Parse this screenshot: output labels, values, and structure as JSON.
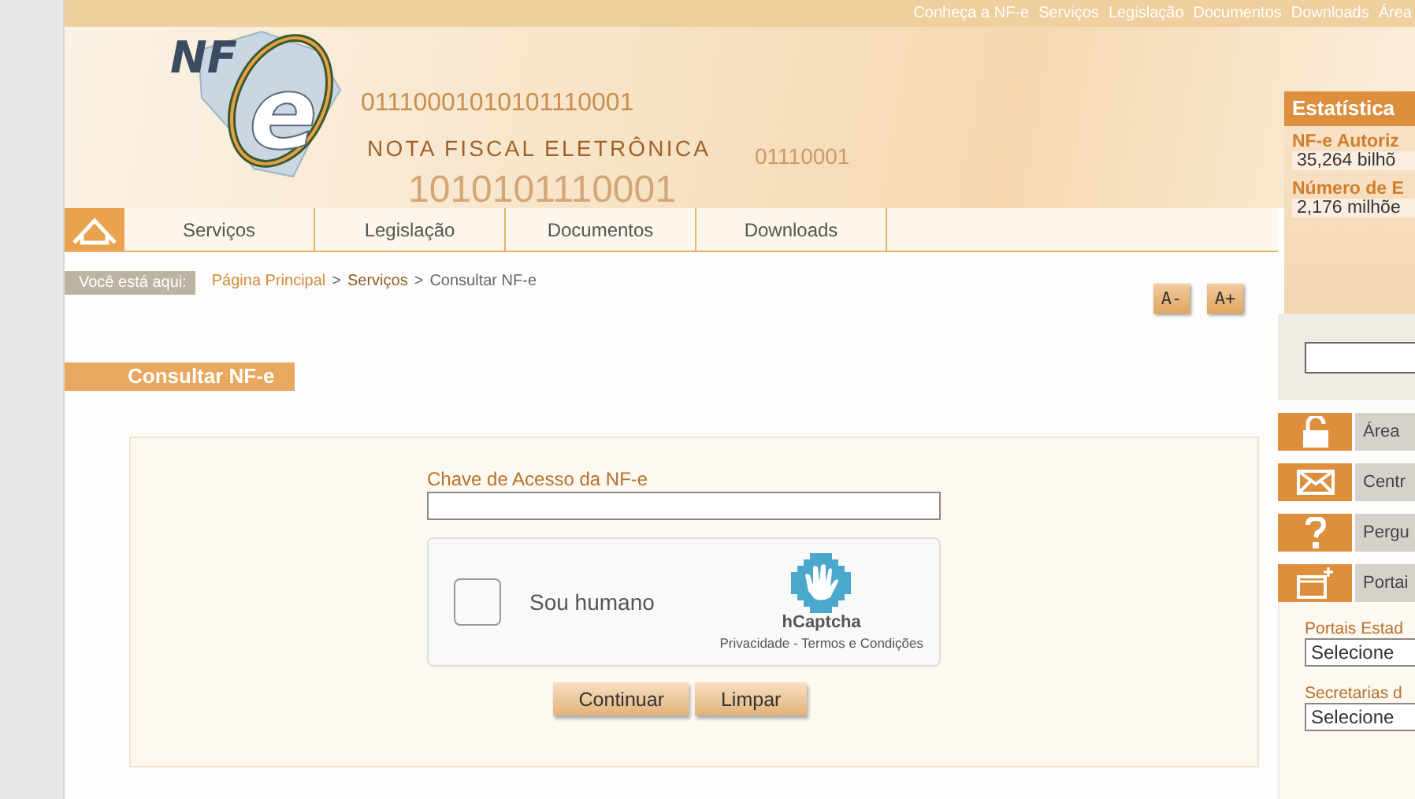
{
  "top_links": [
    "Conheça a NF-e",
    "Serviços",
    "Legislação",
    "Documentos",
    "Downloads",
    "Área"
  ],
  "logo": {
    "prefix": "NF",
    "letter": "e",
    "subtitle": "NOTA FISCAL ELETRÔNICA"
  },
  "banner_digits": [
    "01110001010101110001",
    "01110001",
    "1010101110001"
  ],
  "nav": {
    "items": [
      "Serviços",
      "Legislação",
      "Documentos",
      "Downloads"
    ]
  },
  "breadcrumb": {
    "label": "Você está aqui:",
    "links": [
      "Página Principal",
      "Serviços"
    ],
    "current": "Consultar NF-e",
    "separator": ">"
  },
  "font_buttons": [
    "A-",
    "A+"
  ],
  "page_title": "Consultar NF-e",
  "form": {
    "field_label": "Chave de Acesso da NF-e",
    "captcha": {
      "checked": false,
      "label": "Sou humano",
      "brand": "hCaptcha",
      "links": "Privacidade - Termos e Condições"
    },
    "buttons": [
      "Continuar",
      "Limpar"
    ]
  },
  "sidebar": {
    "title": "Estatística",
    "stats": [
      {
        "label": "NF-e Autoriz",
        "value": "35,264 bilhõ"
      },
      {
        "label": "Número de E",
        "value": "2,176 milhõe"
      }
    ],
    "menu": [
      {
        "kind": "lock",
        "label": "Área"
      },
      {
        "kind": "mail",
        "label": "Centr"
      },
      {
        "kind": "help",
        "label": "Pergu"
      },
      {
        "kind": "window",
        "label": "Portai"
      }
    ],
    "selects": [
      {
        "label": "Portais Estad",
        "value": "Selecione"
      },
      {
        "label": "Secretarias d",
        "value": "Selecione"
      }
    ]
  }
}
